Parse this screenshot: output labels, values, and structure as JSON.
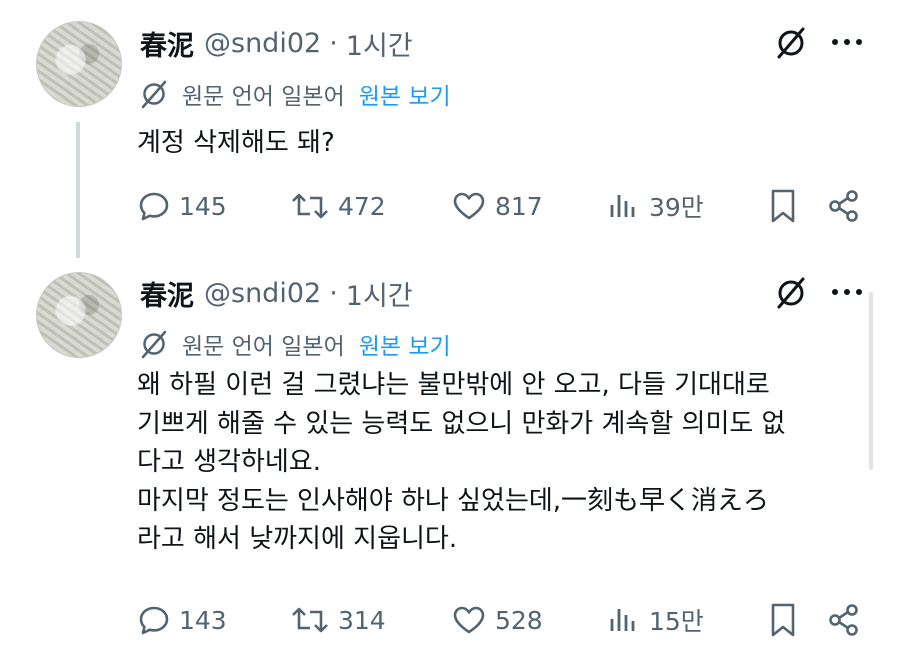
{
  "tweets": [
    {
      "author_name": "春泥",
      "handle": "@sndi02",
      "separator": "·",
      "time": "1시간",
      "translation_label": "원문 언어 일본어",
      "translation_link": "원본 보기",
      "lines": [
        "계정 삭제해도 돼?"
      ],
      "replies": "145",
      "retweets": "472",
      "likes": "817",
      "views": "39만"
    },
    {
      "author_name": "春泥",
      "handle": "@sndi02",
      "separator": "·",
      "time": "1시간",
      "translation_label": "원문 언어 일본어",
      "translation_link": "원본 보기",
      "lines": [
        "왜 하필 이런 걸 그렸냐는 불만밖에 안 오고, 다들 기대대로",
        "기쁘게 해줄 수 있는 능력도 없으니 만화가 계속할 의미도 없",
        "다고 생각하네요.",
        "마지막 정도는 인사해야 하나 싶었는데,一刻も早く消えろ",
        "라고 해서 낮까지에 지웁니다."
      ],
      "replies": "143",
      "retweets": "314",
      "likes": "528",
      "views": "15만"
    }
  ],
  "icons": {
    "translate": "slashed-circle-icon",
    "more": "more-icon",
    "reply": "reply-icon",
    "retweet": "retweet-icon",
    "like": "heart-icon",
    "views": "views-icon",
    "bookmark": "bookmark-icon",
    "share": "share-icon"
  },
  "colors": {
    "text": "#0f1419",
    "secondary": "#536471",
    "link": "#1d9bf0",
    "thread_line": "#cfd9de"
  }
}
